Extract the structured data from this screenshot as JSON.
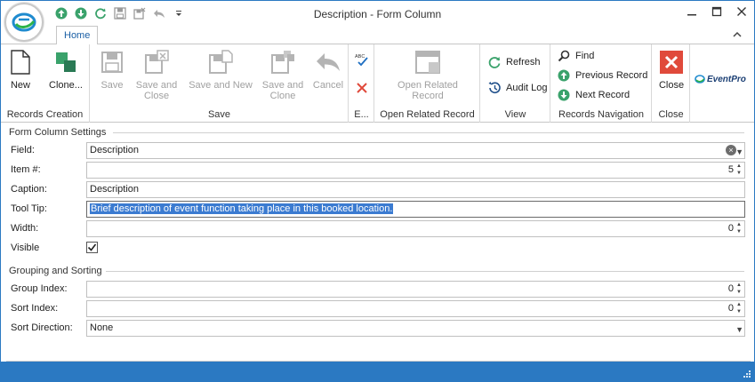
{
  "window": {
    "title": "Description - Form Column"
  },
  "quick_access": {
    "icons": [
      "up-arrow-icon",
      "down-arrow-icon",
      "refresh-icon",
      "save-icon",
      "save-close-icon",
      "undo-icon",
      "customize-dropdown-icon"
    ]
  },
  "tabs": [
    {
      "label": "Home"
    }
  ],
  "ribbon": {
    "records_creation": {
      "label": "Records Creation",
      "new": "New",
      "clone": "Clone..."
    },
    "save": {
      "label": "Save",
      "save": "Save",
      "save_and_close": [
        "Save and",
        "Close"
      ],
      "save_and_new": "Save and New",
      "save_and_clone": [
        "Save and",
        "Clone"
      ],
      "cancel": "Cancel"
    },
    "edit": {
      "label": "E..."
    },
    "open_related": {
      "label": "Open Related Record",
      "button": [
        "Open Related",
        "Record"
      ]
    },
    "view": {
      "label": "View",
      "refresh": "Refresh",
      "audit_log": "Audit Log"
    },
    "navigation": {
      "label": "Records Navigation",
      "find": "Find",
      "previous": "Previous Record",
      "next": "Next Record"
    },
    "close": {
      "label": "Close",
      "button": "Close"
    },
    "brand": "EventPro"
  },
  "form_column_settings": {
    "title": "Form Column Settings",
    "field": {
      "label": "Field:",
      "value": "Description"
    },
    "item_no": {
      "label": "Item #:",
      "value": "5"
    },
    "caption": {
      "label": "Caption:",
      "value": "Description"
    },
    "tooltip": {
      "label": "Tool Tip:",
      "value": "Brief description of event function taking place in this booked location."
    },
    "width": {
      "label": "Width:",
      "value": "0"
    },
    "visible": {
      "label": "Visible",
      "checked": true
    }
  },
  "grouping_sorting": {
    "title": "Grouping and Sorting",
    "group_index": {
      "label": "Group Index:",
      "value": "0"
    },
    "sort_index": {
      "label": "Sort Index:",
      "value": "0"
    },
    "sort_direction": {
      "label": "Sort Direction:",
      "value": "None"
    }
  },
  "colors": {
    "accent": "#2b79c2",
    "close_red": "#e04a3b",
    "green_icon": "#3aa26b",
    "selection": "#3b7bd1"
  }
}
